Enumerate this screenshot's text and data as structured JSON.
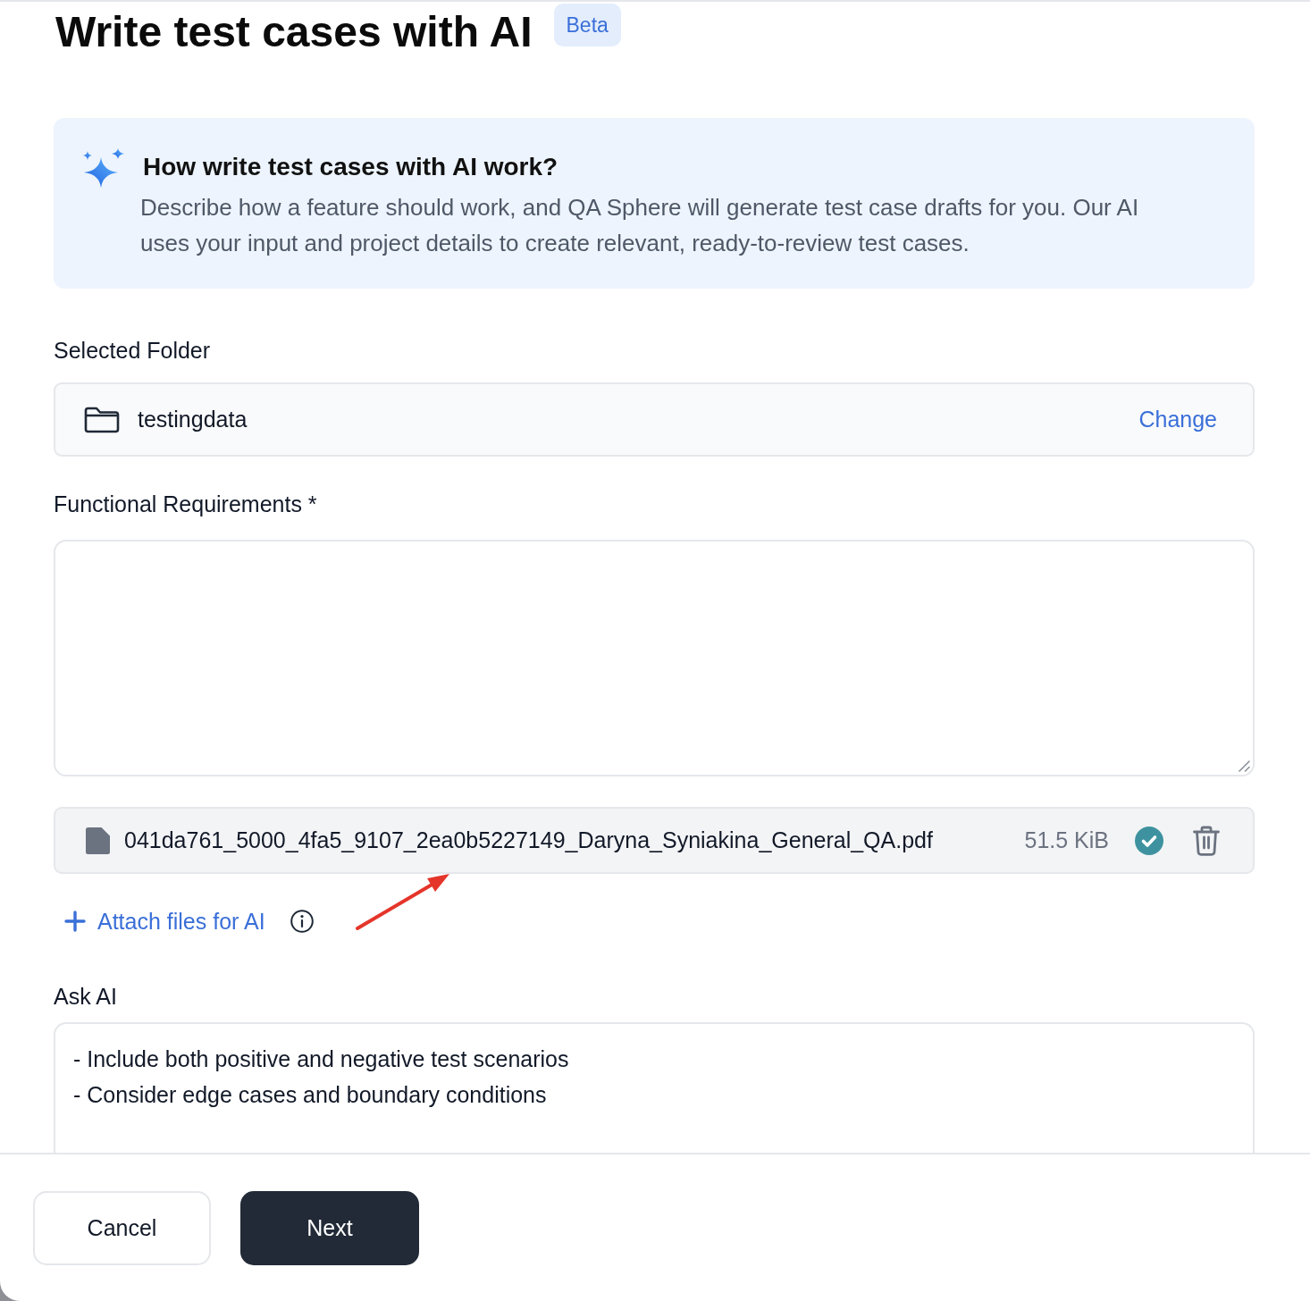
{
  "page": {
    "title": "Write test cases with AI",
    "badge": "Beta"
  },
  "info_box": {
    "heading": "How write test cases with AI work?",
    "text": "Describe how a feature should work, and QA Sphere will generate test case drafts for you. Our AI uses your input and project details to create relevant, ready-to-review test cases."
  },
  "selected_folder": {
    "label": "Selected Folder",
    "folder_name": "testingdata",
    "action": "Change"
  },
  "functional_requirements": {
    "label": "Functional Requirements *"
  },
  "attachments": [
    {
      "file_name": "041da761_5000_4fa5_9107_2ea0b5227149_Daryna_Syniakina_General_QA.pdf",
      "size": "51.5 KiB",
      "uploaded": true
    }
  ],
  "attach_button": {
    "label": "Attach files for AI"
  },
  "ask_ai": {
    "label": "Ask AI",
    "value": "- Include both positive and negative test scenarios\n- Consider edge cases and boundary conditions"
  },
  "footer_buttons": [
    {
      "label": "Cancel",
      "kind": "secondary"
    },
    {
      "label": "Next",
      "kind": "primary"
    }
  ]
}
